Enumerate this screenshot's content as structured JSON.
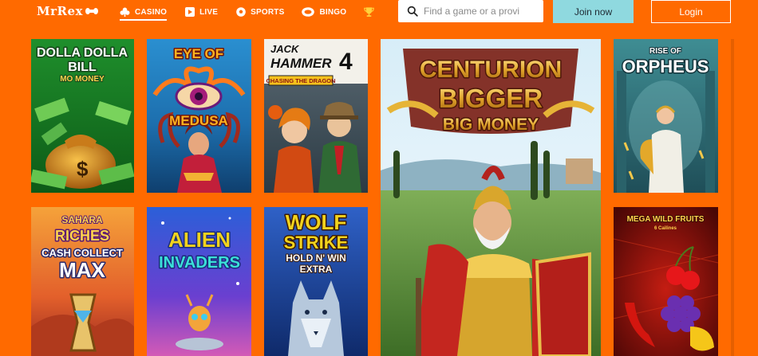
{
  "header": {
    "logo": "MrRex",
    "nav": [
      {
        "id": "casino",
        "label": "CASINO",
        "icon": "club-icon",
        "active": true
      },
      {
        "id": "live",
        "label": "LIVE",
        "icon": "live-play-icon",
        "active": false
      },
      {
        "id": "sports",
        "label": "SPORTS",
        "icon": "soccer-ball-icon",
        "active": false
      },
      {
        "id": "bingo",
        "label": "BINGO",
        "icon": "bingo-ball-icon",
        "active": false
      }
    ],
    "trophy_icon": "trophy-icon",
    "search": {
      "placeholder": "Find a game or a provi",
      "value": ""
    },
    "join_label": "Join now",
    "login_label": "Login"
  },
  "games": [
    {
      "id": "dolla",
      "title_lines": [
        "DOLLA DOLLA",
        "BILL"
      ],
      "subtitle": "MO MONEY"
    },
    {
      "id": "medusa",
      "title_lines": [
        "EYE OF",
        "MEDUSA"
      ]
    },
    {
      "id": "jack",
      "title_lines": [
        "JACK",
        "HAMMER",
        "4"
      ],
      "subtitle": "CHASING THE DRAGON"
    },
    {
      "id": "centurion",
      "title_lines": [
        "CENTURION",
        "BIGGER",
        "BIG MONEY"
      ]
    },
    {
      "id": "orpheus",
      "title_lines": [
        "RISE OF",
        "ORPHEUS"
      ]
    },
    {
      "id": "sahara",
      "title_lines": [
        "SAHARA",
        "RICHES",
        "CASH COLLECT",
        "MAX"
      ]
    },
    {
      "id": "alien",
      "title_lines": [
        "ALIEN",
        "INVADERS"
      ]
    },
    {
      "id": "wolf",
      "title_lines": [
        "WOLF",
        "STRIKE",
        "HOLD N' WIN",
        "EXTRA"
      ]
    },
    {
      "id": "mega",
      "title_lines": [
        "MEGA WILD FRUITS",
        "6 Cailines"
      ]
    }
  ],
  "colors": {
    "background": "#ff6a00",
    "join_button": "#8fd9df",
    "text_light": "#ffffff"
  }
}
